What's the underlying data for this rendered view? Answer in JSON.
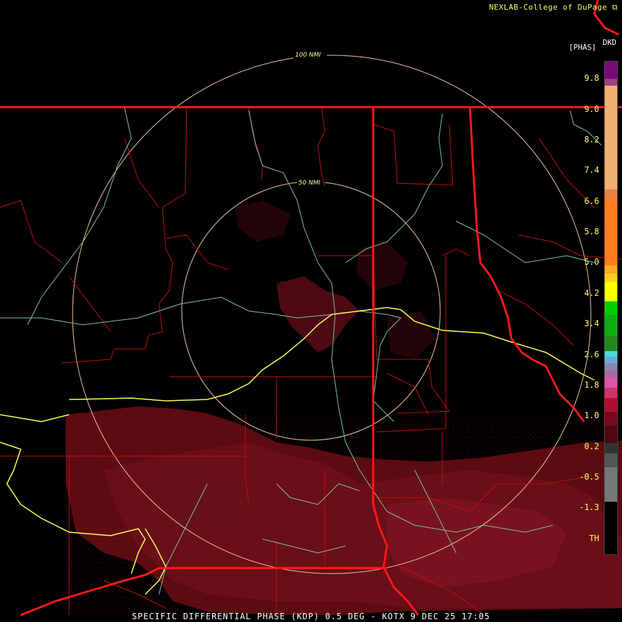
{
  "header": {
    "credit": "NEXLAB-College of DuPage",
    "credit_icon": "external-link-icon",
    "product_code": "DKD",
    "unit": "[PHAS]"
  },
  "rings": [
    {
      "label": "100 NMI"
    },
    {
      "label": "50 NMI"
    }
  ],
  "legend": {
    "ticks": [
      "9.8",
      "9.0",
      "8.2",
      "7.4",
      "6.6",
      "5.8",
      "5.0",
      "4.2",
      "3.4",
      "2.6",
      "1.8",
      "1.0",
      "0.2",
      "-0.5",
      "-1.3",
      "TH"
    ]
  },
  "footer": {
    "caption": "SPECIFIC DIFFERENTIAL PHASE (KDP) 0.5 DEG - KOTX 9 DEC 25 17:05"
  },
  "colors": {
    "state_border": "#ff1a1a",
    "county_line": "#d01010",
    "highway": "#ffff55",
    "river": "#80c8a0",
    "ring": "#f0c8a0",
    "echo": "#5c0a12",
    "label": "#ffff66"
  }
}
